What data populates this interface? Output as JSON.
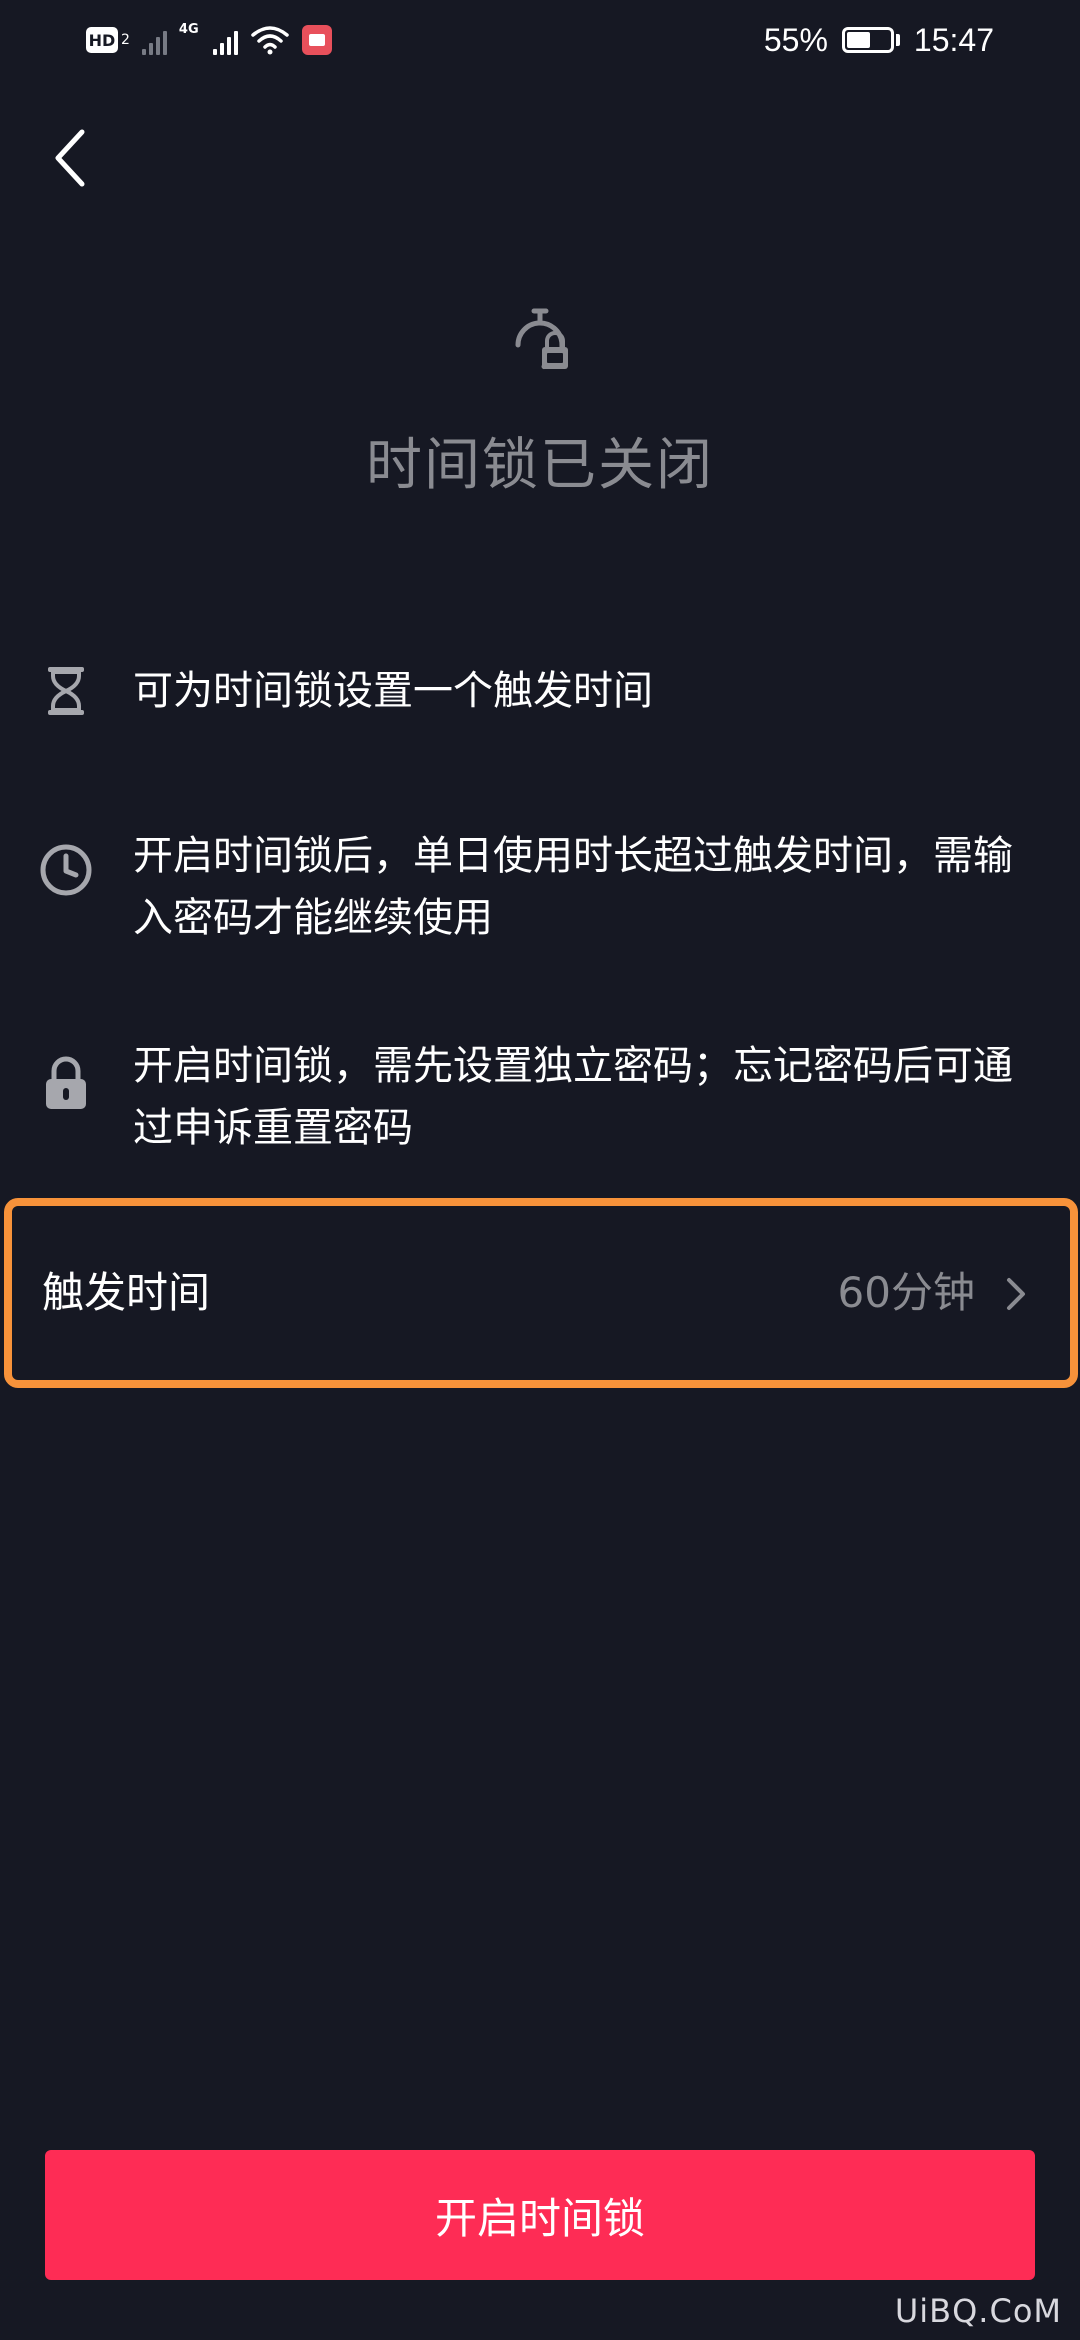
{
  "status_bar": {
    "hd_label": "HD",
    "hd_sub": "2",
    "net_label": "4G",
    "battery_percent": "55%",
    "battery_level": 0.55,
    "time": "15:47"
  },
  "header": {
    "title": "时间锁已关闭",
    "icon": "timer-lock-icon"
  },
  "info_items": [
    {
      "icon": "hourglass-icon",
      "text": "可为时间锁设置一个触发时间"
    },
    {
      "icon": "clock-icon",
      "text": "开启时间锁后，单日使用时长超过触发时间，需输入密码才能继续使用"
    },
    {
      "icon": "lock-icon",
      "text": "开启时间锁，需先设置独立密码；忘记密码后可通过申诉重置密码"
    }
  ],
  "trigger": {
    "label": "触发时间",
    "value": "60分钟"
  },
  "footer": {
    "enable_label": "开启时间锁"
  },
  "watermark": "UiBQ.CoM",
  "colors": {
    "background": "#161823",
    "accent": "#fe2c55",
    "highlight": "#f7923a",
    "muted": "#8a8b91"
  }
}
